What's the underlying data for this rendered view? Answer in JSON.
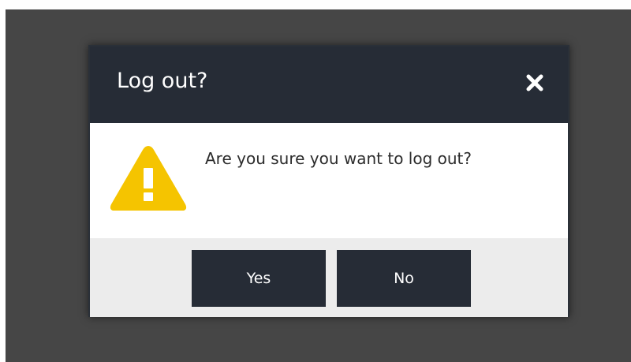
{
  "dialog": {
    "title": "Log out?",
    "close_icon": "close-x-icon",
    "warning_icon": "warning-triangle-icon",
    "message": "Are you sure you want to log out?",
    "buttons": {
      "yes_label": "Yes",
      "no_label": "No"
    }
  },
  "colors": {
    "backdrop": "#464646",
    "titlebar": "#262c36",
    "button": "#262c36",
    "footer": "#ececec",
    "warning": "#f5c400"
  }
}
